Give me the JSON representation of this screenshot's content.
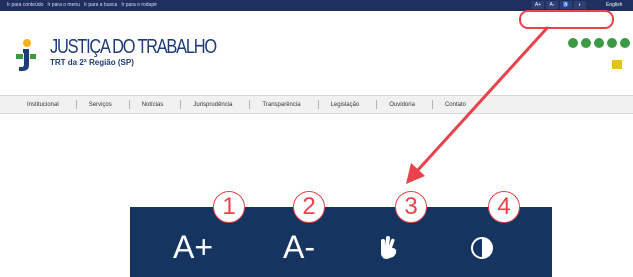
{
  "topbar": {
    "skip_links": [
      "Ir para conteúdo",
      "Ir para o menu",
      "Ir para a busca",
      "Ir para o rodapé"
    ],
    "mini_tools": [
      "A+",
      "A-",
      "♿",
      "◐"
    ],
    "language": "English"
  },
  "logo": {
    "title": "JUSTIÇA DO TRABALHO",
    "subtitle": "TRT da 2ª Região (SP)"
  },
  "nav": {
    "items": [
      "Institucional",
      "Serviços",
      "Notícias",
      "Jurisprudência",
      "Transparência",
      "Legislação",
      "Ouvidoria",
      "Contato"
    ]
  },
  "accessibility_bar": {
    "buttons": [
      {
        "label": "A+",
        "number": "1"
      },
      {
        "label": "A-",
        "number": "2"
      },
      {
        "label": "hand-sign",
        "number": "3"
      },
      {
        "label": "contrast",
        "number": "4"
      }
    ]
  },
  "colors": {
    "navy": "#153460",
    "highlight": "#e8434a",
    "logo_blue": "#1f3b7a",
    "social_green": "#3c9a45"
  },
  "icons": {
    "logo": "trt-person-icon",
    "libras": "hand-sign-icon",
    "contrast": "contrast-icon"
  }
}
